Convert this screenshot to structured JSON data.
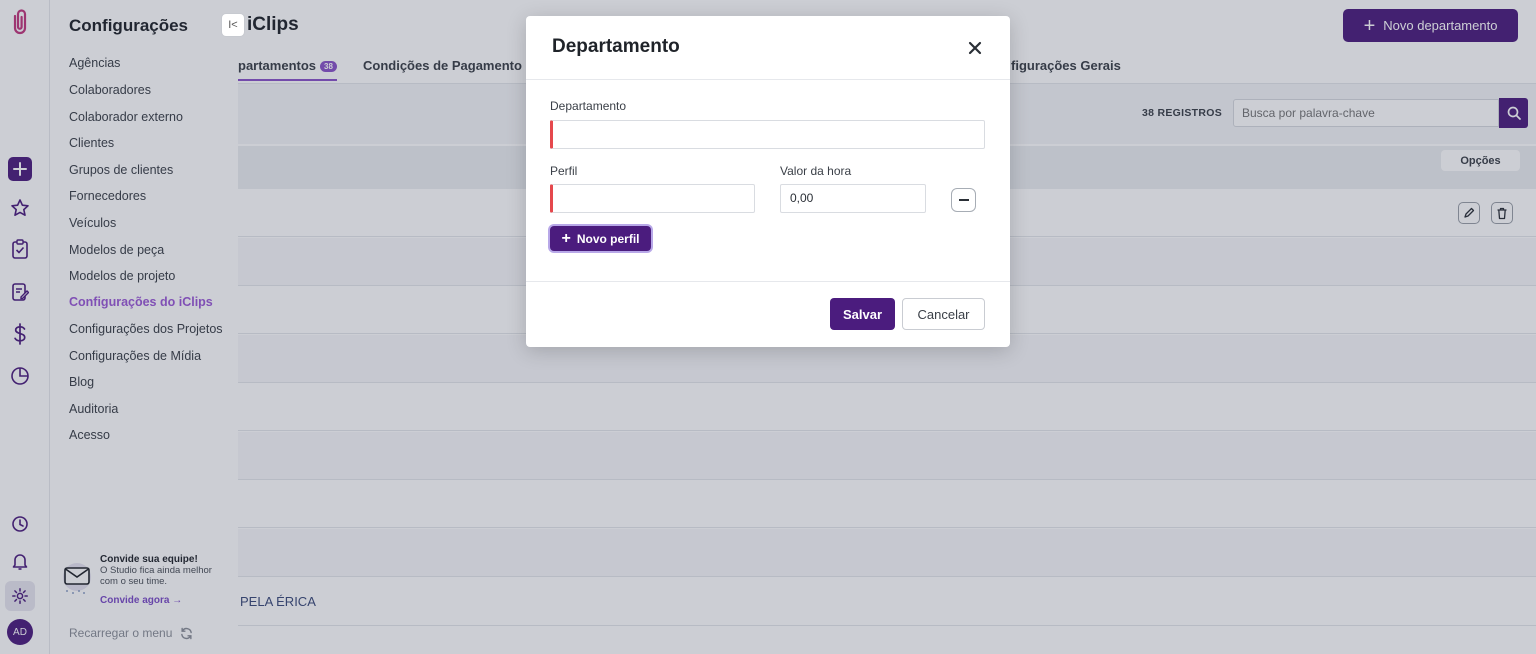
{
  "rail": {
    "icons": [
      "paperclip-logo-icon",
      "plus-icon",
      "star-icon",
      "clipboard-check-icon",
      "edit-document-icon",
      "dollar-icon",
      "pie-chart-icon",
      "clock-icon",
      "bell-icon",
      "gear-icon"
    ],
    "avatar_initials": "AD"
  },
  "menu": {
    "title": "Configurações",
    "items": [
      "Agências",
      "Colaboradores",
      "Colaborador externo",
      "Clientes",
      "Grupos de clientes",
      "Fornecedores",
      "Veículos",
      "Modelos de peça",
      "Modelos de projeto",
      "Configurações do iClips",
      "Configurações dos Projetos",
      "Configurações de Mídia",
      "Blog",
      "Auditoria",
      "Acesso"
    ],
    "active_item": "Configurações do iClips",
    "invite": {
      "title": "Convide sua equipe!",
      "text": "O Studio fica ainda melhor com o seu time.",
      "link": "Convide agora →"
    },
    "reload": "Recarregar o menu"
  },
  "main": {
    "collapse_glyph": "I<",
    "title": "iClips",
    "new_button": "Novo departamento",
    "tabs": [
      {
        "label": "partamentos",
        "badge": "38"
      },
      {
        "label": "Condições de Pagamento"
      },
      {
        "label": "figurações Gerais"
      }
    ],
    "records": "38 REGISTROS",
    "search_placeholder": "Busca por palavra-chave",
    "options_label": "Opções",
    "rows": [
      "",
      "",
      "",
      "",
      "",
      "",
      "",
      "",
      "PELA ÉRICA"
    ]
  },
  "modal": {
    "title": "Departamento",
    "department_label": "Departamento",
    "department_value": "",
    "profile_label": "Perfil",
    "profile_value": "",
    "hour_value_label": "Valor da hora",
    "hour_value": "0,00",
    "new_profile_button": "Novo perfil",
    "save_button": "Salvar",
    "cancel_button": "Cancelar"
  },
  "colors": {
    "brand": "#4b1c7e",
    "accent": "#8b54c9",
    "required": "#e5484d"
  }
}
